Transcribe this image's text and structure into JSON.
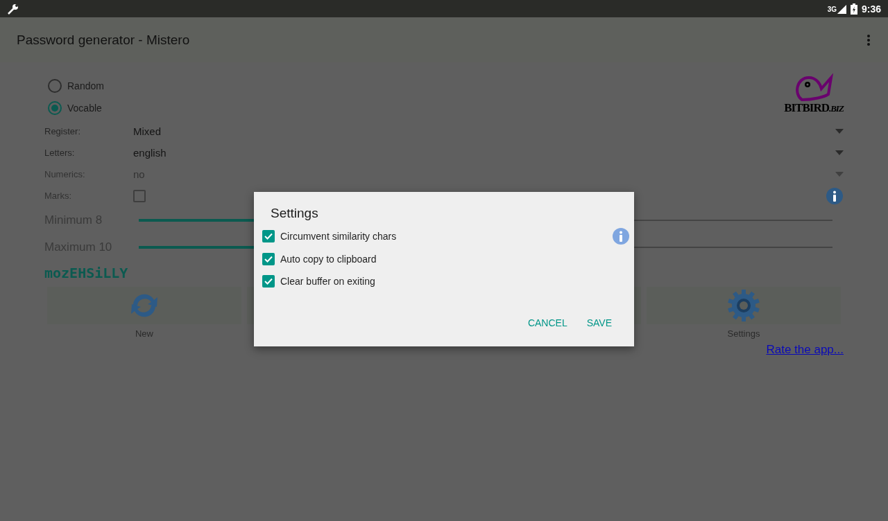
{
  "status_bar": {
    "time": "9:36",
    "network": "3G"
  },
  "app_bar": {
    "title": "Password generator - Mistero"
  },
  "modes": [
    {
      "label": "Random",
      "selected": false
    },
    {
      "label": "Vocable",
      "selected": true
    }
  ],
  "logo": {
    "text": "BITBIRD",
    "suffix": ".BIZ"
  },
  "options": [
    {
      "kind": "dropdown",
      "label": "Register:",
      "value": "Mixed",
      "disabled": false
    },
    {
      "kind": "dropdown",
      "label": "Letters:",
      "value": "english",
      "disabled": false
    },
    {
      "kind": "dropdown",
      "label": "Numerics:",
      "value": "no",
      "disabled": true
    },
    {
      "kind": "checkbox",
      "label": "Marks:",
      "checked": false,
      "disabled": true
    }
  ],
  "sliders": [
    {
      "label": "Minimum 8",
      "level": 0.3
    },
    {
      "label": "Maximum 10",
      "level": 0.34
    }
  ],
  "password": "mozEHSiLLY",
  "actions": [
    {
      "kind": "refresh",
      "label": "New"
    },
    {
      "kind": "blank"
    },
    {
      "kind": "blank"
    },
    {
      "kind": "gear",
      "label": "Settings"
    }
  ],
  "rate_link": "Rate the app...",
  "dialog": {
    "title": "Settings",
    "options": [
      {
        "label": "Circumvent similarity chars",
        "checked": true
      },
      {
        "label": "Auto copy to clipboard",
        "checked": true
      },
      {
        "label": "Clear buffer on exiting",
        "checked": true
      }
    ],
    "buttons": [
      "CANCEL",
      "SAVE"
    ]
  }
}
